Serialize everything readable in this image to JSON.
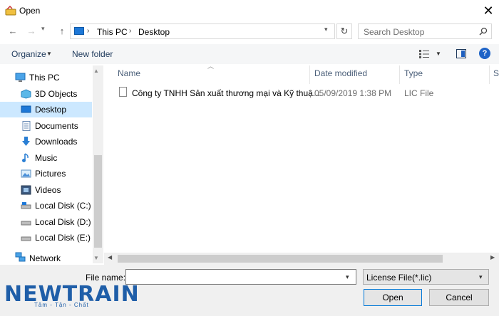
{
  "window": {
    "title": "Open",
    "close_symbol": "✕"
  },
  "address_bar": {
    "crumbs": [
      "This PC",
      "Desktop"
    ],
    "separator": "›"
  },
  "search": {
    "placeholder": "Search Desktop"
  },
  "toolbar": {
    "organize_label": "Organize",
    "new_folder_label": "New folder",
    "help_symbol": "?"
  },
  "nav_pane": {
    "items": [
      {
        "label": "This PC",
        "icon": "computer-icon"
      },
      {
        "label": "3D Objects",
        "icon": "3d-objects-icon"
      },
      {
        "label": "Desktop",
        "icon": "desktop-icon",
        "selected": true
      },
      {
        "label": "Documents",
        "icon": "documents-icon"
      },
      {
        "label": "Downloads",
        "icon": "downloads-icon"
      },
      {
        "label": "Music",
        "icon": "music-icon"
      },
      {
        "label": "Pictures",
        "icon": "pictures-icon"
      },
      {
        "label": "Videos",
        "icon": "videos-icon"
      },
      {
        "label": "Local Disk (C:)",
        "icon": "drive-icon"
      },
      {
        "label": "Local Disk (D:)",
        "icon": "drive-icon"
      },
      {
        "label": "Local Disk (E:)",
        "icon": "drive-icon"
      },
      {
        "label": "Network",
        "icon": "network-icon"
      }
    ]
  },
  "file_list": {
    "columns": [
      "Name",
      "Date modified",
      "Type",
      "Si"
    ],
    "rows": [
      {
        "name": "Công ty TNHH Sản xuất thương mại và Kỹ thuậ...",
        "date_modified": "05/09/2019 1:38 PM",
        "type": "LIC File"
      }
    ]
  },
  "footer": {
    "file_name_label": "File name:",
    "file_name_value": "",
    "file_type_value": "License File(*.lic)",
    "open_label": "Open",
    "cancel_label": "Cancel"
  },
  "watermark": {
    "brand": "NEWTRAIN",
    "tagline": "Tâm - Tận - Chất"
  },
  "colors": {
    "accent": "#0078d7",
    "selection": "#cce8ff",
    "link_text": "#1e395b"
  }
}
